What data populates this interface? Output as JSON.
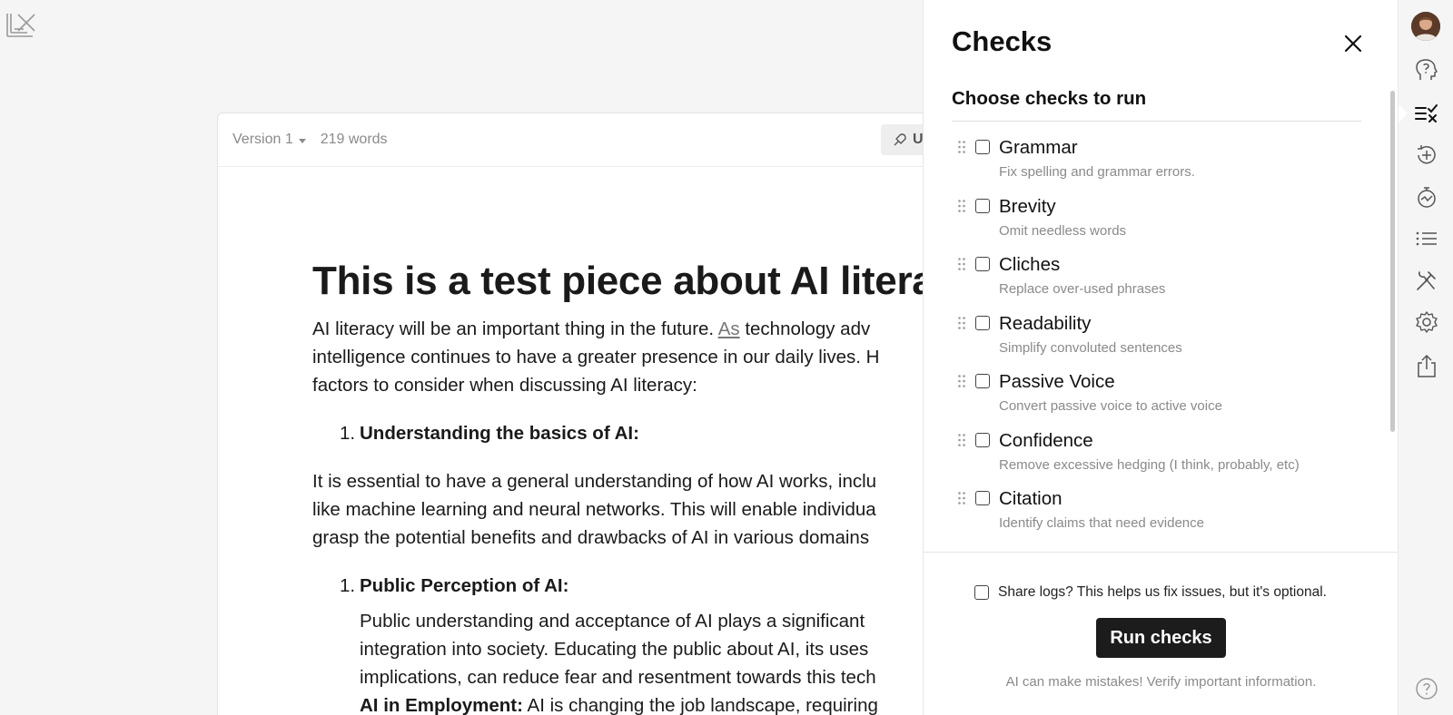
{
  "app": {
    "logo_icon": "lex-logo-icon"
  },
  "toolbar": {
    "version_label": "Version 1",
    "word_count": "219 words",
    "upgrade_label": "U"
  },
  "document": {
    "title": "This is a test piece about AI litera",
    "intro_lines": [
      {
        "before": "AI literacy will be an important thing in the future. ",
        "underlined": "As",
        "after": " technology adv"
      },
      "intelligence continues to have a greater presence in our daily lives. H",
      "factors to consider when discussing AI literacy:"
    ],
    "list1": {
      "number": "1.",
      "heading": "Understanding the basics of AI:"
    },
    "section1_lines": [
      " It is essential to have a general understanding of how AI works, inclu",
      "like machine learning and neural networks. This will enable individua",
      "grasp the potential benefits and drawbacks of AI in various domains"
    ],
    "list2": {
      "number": "1.",
      "heading": "Public Perception of AI:"
    },
    "section2_lines": [
      " Public understanding and acceptance of AI plays a significant",
      "integration into society. Educating the public about AI, its uses",
      "implications, can reduce fear and resentment towards this tech"
    ],
    "section3": {
      "bold": "AI in Employment:",
      "rest": " AI is changing the job landscape, requiring"
    }
  },
  "checks_panel": {
    "title": "Checks",
    "section_heading": "Choose checks to run",
    "checks": [
      {
        "name": "Grammar",
        "description": "Fix spelling and grammar errors.",
        "checked": false
      },
      {
        "name": "Brevity",
        "description": "Omit needless words",
        "checked": false
      },
      {
        "name": "Cliches",
        "description": "Replace over-used phrases",
        "checked": false
      },
      {
        "name": "Readability",
        "description": "Simplify convoluted sentences",
        "checked": false
      },
      {
        "name": "Passive Voice",
        "description": "Convert passive voice to active voice",
        "checked": false
      },
      {
        "name": "Confidence",
        "description": "Remove excessive hedging (I think, probably, etc)",
        "checked": false
      },
      {
        "name": "Citation",
        "description": "Identify claims that need evidence",
        "checked": false
      }
    ],
    "share_logs_label": "Share logs? This helps us fix issues, but it's optional.",
    "run_button_label": "Run checks",
    "disclaimer": "AI can make mistakes! Verify important information."
  },
  "rail": {
    "icons": [
      "avatar",
      "help-head-icon",
      "checks-icon",
      "sparkle-plus-icon",
      "timer-icon",
      "list-icon",
      "tools-icon",
      "gear-icon",
      "share-icon",
      "help-circle-icon"
    ],
    "active": "checks-icon"
  },
  "colors": {
    "accent": "#1c1c1c",
    "muted_text": "#8a8a8a",
    "background": "#f5f5f5"
  }
}
